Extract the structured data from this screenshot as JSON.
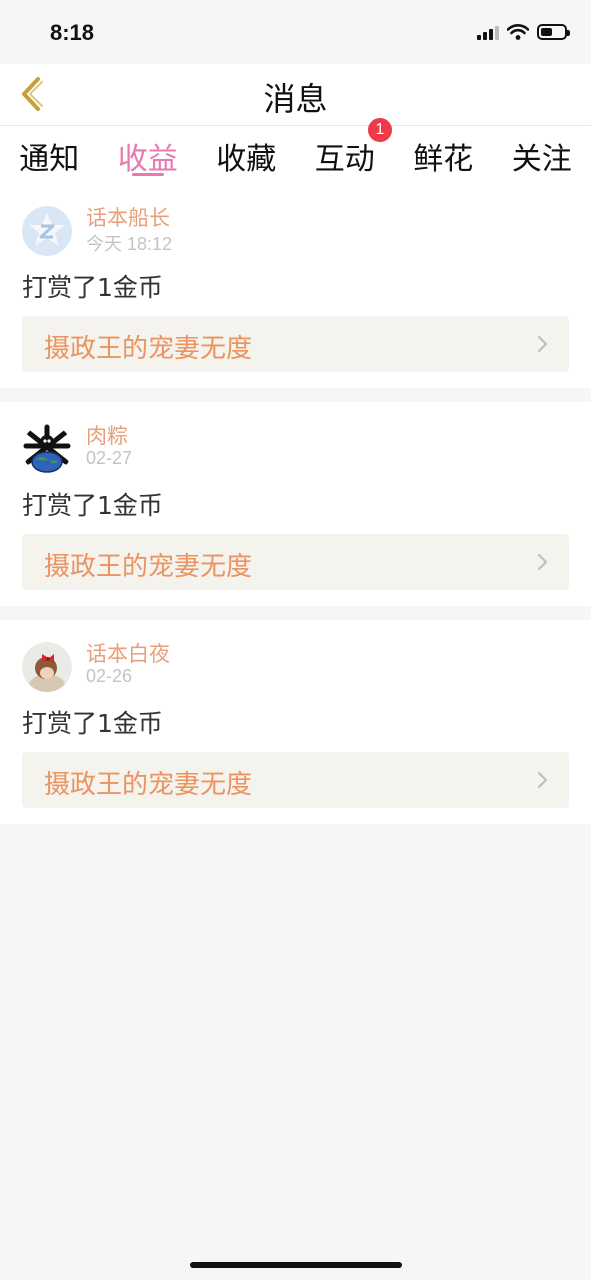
{
  "status_bar": {
    "time": "8:18",
    "battery_level": 0.5
  },
  "nav": {
    "title": "消息",
    "back_icon": "chevron-left-icon",
    "back_color": "#c8a03a"
  },
  "tabs": [
    {
      "label": "通知",
      "active": false
    },
    {
      "label": "收益",
      "active": true
    },
    {
      "label": "收藏",
      "active": false
    },
    {
      "label": "互动",
      "active": false,
      "badge": "1"
    },
    {
      "label": "鲜花",
      "active": false
    },
    {
      "label": "关注",
      "active": false
    }
  ],
  "colors": {
    "accent": "#e879b0",
    "username": "#e8a07a",
    "work_title": "#ec9360",
    "badge": "#ef3a4a"
  },
  "messages": [
    {
      "username": "话本船长",
      "time": "今天 18:12",
      "action": "打赏了1金币",
      "work_title": "摄政王的宠妻无度",
      "avatar_icon": "z-logo-avatar-icon"
    },
    {
      "username": "肉粽",
      "time": "02-27",
      "action": "打赏了1金币",
      "work_title": "摄政王的宠妻无度",
      "avatar_icon": "skull-globe-avatar-icon"
    },
    {
      "username": "话本白夜",
      "time": "02-26",
      "action": "打赏了1金币",
      "work_title": "摄政王的宠妻无度",
      "avatar_icon": "photo-avatar-icon"
    }
  ]
}
